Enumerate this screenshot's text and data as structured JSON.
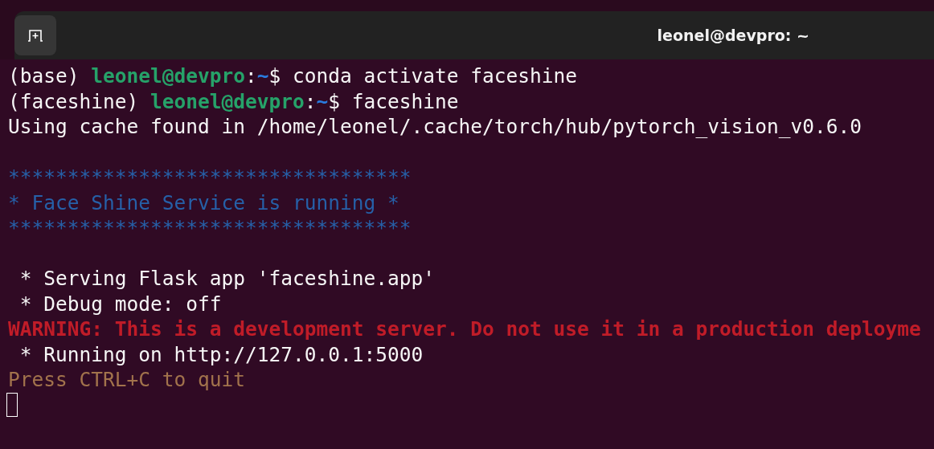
{
  "window": {
    "title": "leonel@devpro: ~"
  },
  "terminal": {
    "lines": [
      {
        "kind": "text",
        "segments": [
          {
            "kind": "plain",
            "text": "(base) "
          },
          {
            "kind": "user",
            "text": "leonel@devpro"
          },
          {
            "kind": "plain",
            "text": ":"
          },
          {
            "kind": "path",
            "text": "~"
          },
          {
            "kind": "plain",
            "text": "$ conda activate faceshine"
          }
        ]
      },
      {
        "kind": "text",
        "segments": [
          {
            "kind": "plain",
            "text": "(faceshine) "
          },
          {
            "kind": "user",
            "text": "leonel@devpro"
          },
          {
            "kind": "plain",
            "text": ":"
          },
          {
            "kind": "path",
            "text": "~"
          },
          {
            "kind": "plain",
            "text": "$ faceshine"
          }
        ]
      },
      {
        "kind": "text",
        "segments": [
          {
            "kind": "plain",
            "text": "Using cache found in /home/leonel/.cache/torch/hub/pytorch_vision_v0.6.0"
          }
        ]
      },
      {
        "kind": "blank"
      },
      {
        "kind": "text",
        "segments": [
          {
            "kind": "banner",
            "text": "**********************************"
          }
        ]
      },
      {
        "kind": "text",
        "segments": [
          {
            "kind": "banner",
            "text": "* Face Shine Service is running *"
          }
        ]
      },
      {
        "kind": "text",
        "segments": [
          {
            "kind": "banner",
            "text": "**********************************"
          }
        ]
      },
      {
        "kind": "blank"
      },
      {
        "kind": "text",
        "segments": [
          {
            "kind": "plain",
            "text": " * Serving Flask app 'faceshine.app'"
          }
        ]
      },
      {
        "kind": "text",
        "segments": [
          {
            "kind": "plain",
            "text": " * Debug mode: off"
          }
        ]
      },
      {
        "kind": "text",
        "segments": [
          {
            "kind": "error",
            "text": "WARNING: This is a development server. Do not use it in a production deployme"
          }
        ]
      },
      {
        "kind": "text",
        "segments": [
          {
            "kind": "plain",
            "text": " * Running on http://127.0.0.1:5000"
          }
        ]
      },
      {
        "kind": "text",
        "segments": [
          {
            "kind": "notice",
            "text": "Press CTRL+C to quit"
          }
        ]
      },
      {
        "kind": "cursor"
      }
    ]
  }
}
